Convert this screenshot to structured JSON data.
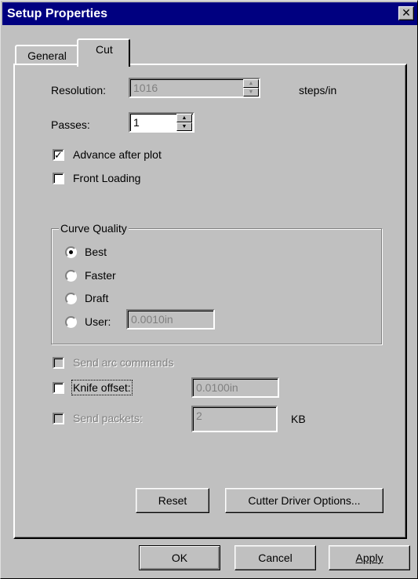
{
  "window": {
    "title": "Setup Properties",
    "close_glyph": "✕"
  },
  "tabs": [
    {
      "label": "General"
    },
    {
      "label": "Cut",
      "active": true
    }
  ],
  "cut": {
    "resolution": {
      "label": "Resolution:",
      "value": "1016",
      "unit": "steps/in"
    },
    "passes": {
      "label": "Passes:",
      "value": "1"
    },
    "advance_after_plot": {
      "label": "Advance after plot",
      "checked": true
    },
    "front_loading": {
      "label": "Front Loading",
      "checked": false
    },
    "curve_quality": {
      "legend": "Curve Quality",
      "options": [
        {
          "label": "Best",
          "selected": true
        },
        {
          "label": "Faster",
          "selected": false
        },
        {
          "label": "Draft",
          "selected": false
        },
        {
          "label": "User:",
          "selected": false
        }
      ],
      "user_value": "0.0010in"
    },
    "send_arc_commands": {
      "label": "Send arc commands",
      "checked": false,
      "enabled": false
    },
    "knife_offset": {
      "label": "Knife offset:",
      "checked": false,
      "value": "0.0100in"
    },
    "send_packets": {
      "label": "Send packets:",
      "checked": false,
      "value": "2",
      "unit": "KB",
      "enabled": false
    },
    "reset_label": "Reset",
    "driver_options_label": "Cutter Driver Options..."
  },
  "footer": {
    "ok_label": "OK",
    "cancel_label": "Cancel",
    "apply_label": "Apply"
  }
}
